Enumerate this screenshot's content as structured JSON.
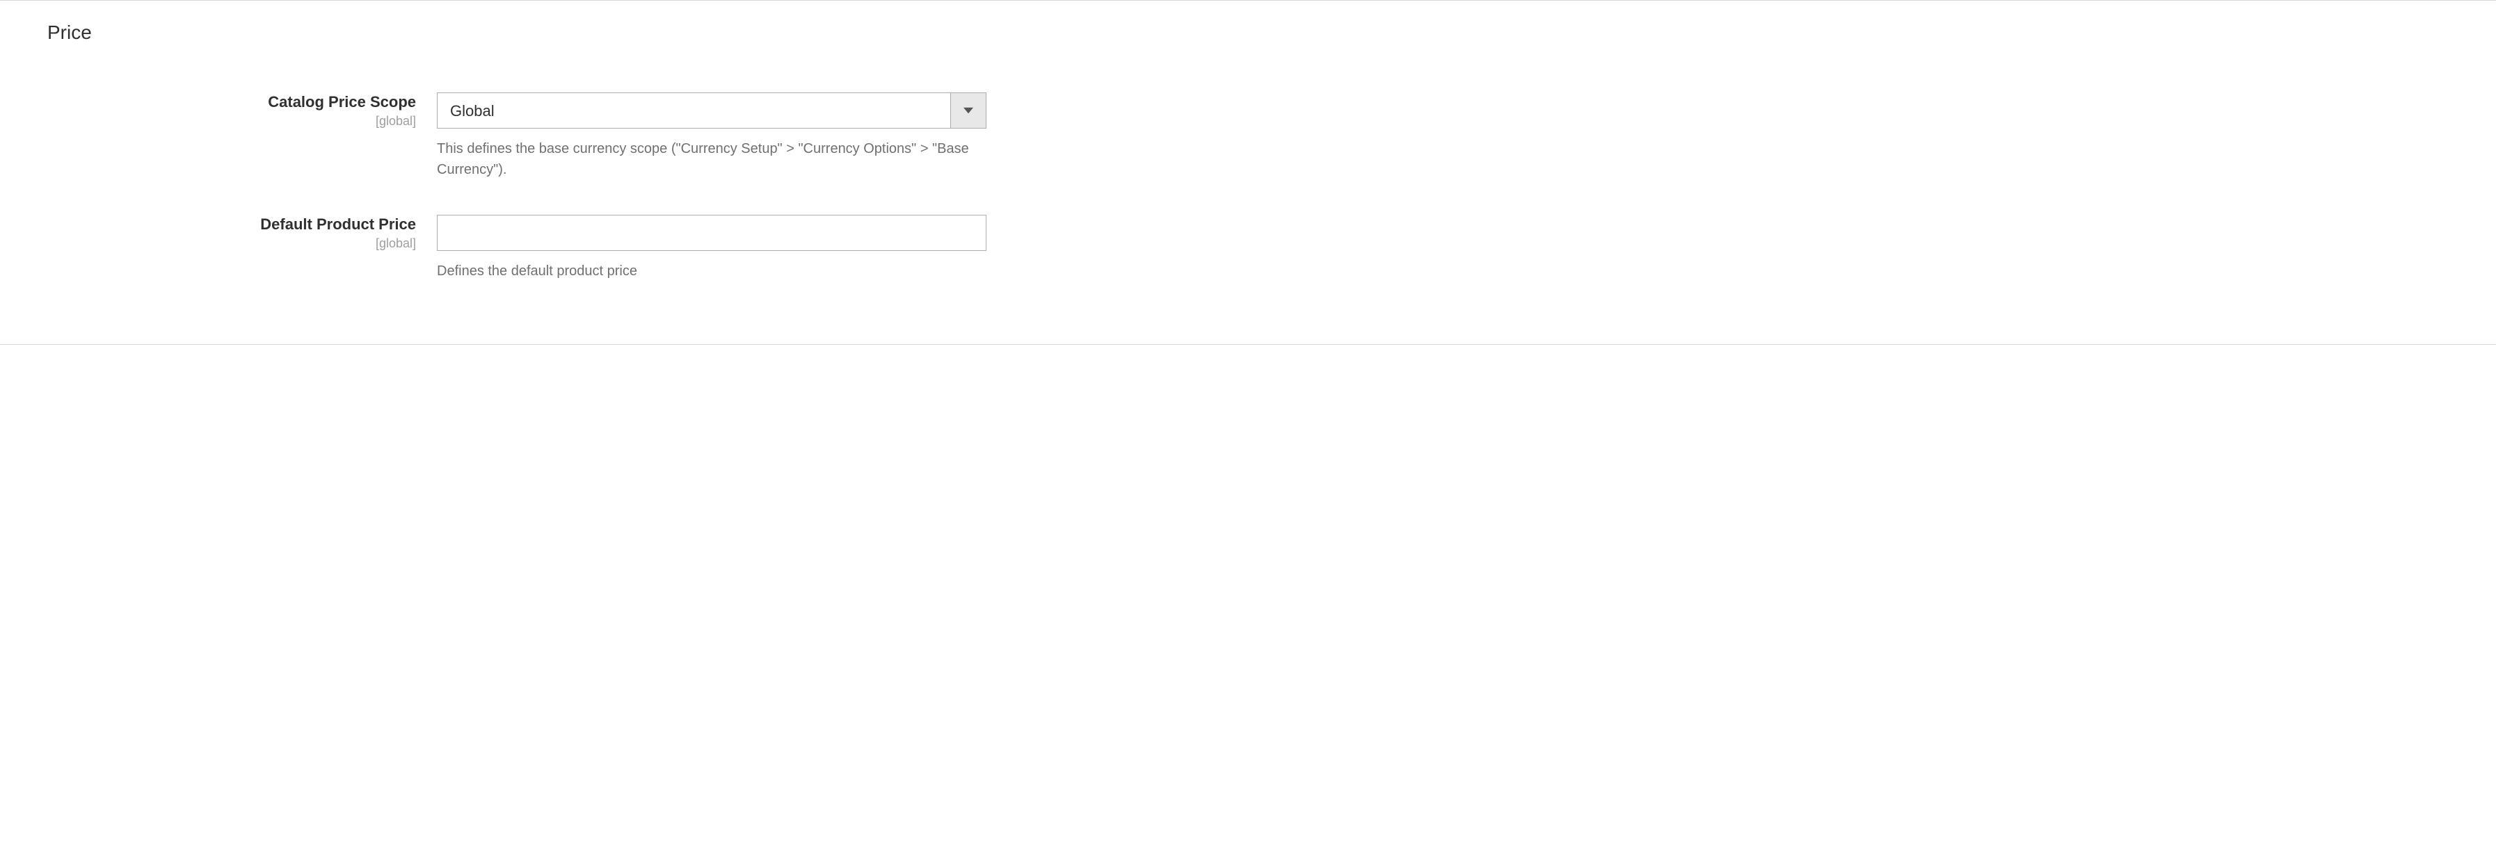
{
  "section": {
    "title": "Price"
  },
  "fields": {
    "catalog_price_scope": {
      "label": "Catalog Price Scope",
      "scope": "[global]",
      "selected": "Global",
      "comment": "This defines the base currency scope (\"Currency Setup\" > \"Currency Options\" > \"Base Currency\")."
    },
    "default_product_price": {
      "label": "Default Product Price",
      "scope": "[global]",
      "value": "",
      "comment": "Defines the default product price"
    }
  }
}
